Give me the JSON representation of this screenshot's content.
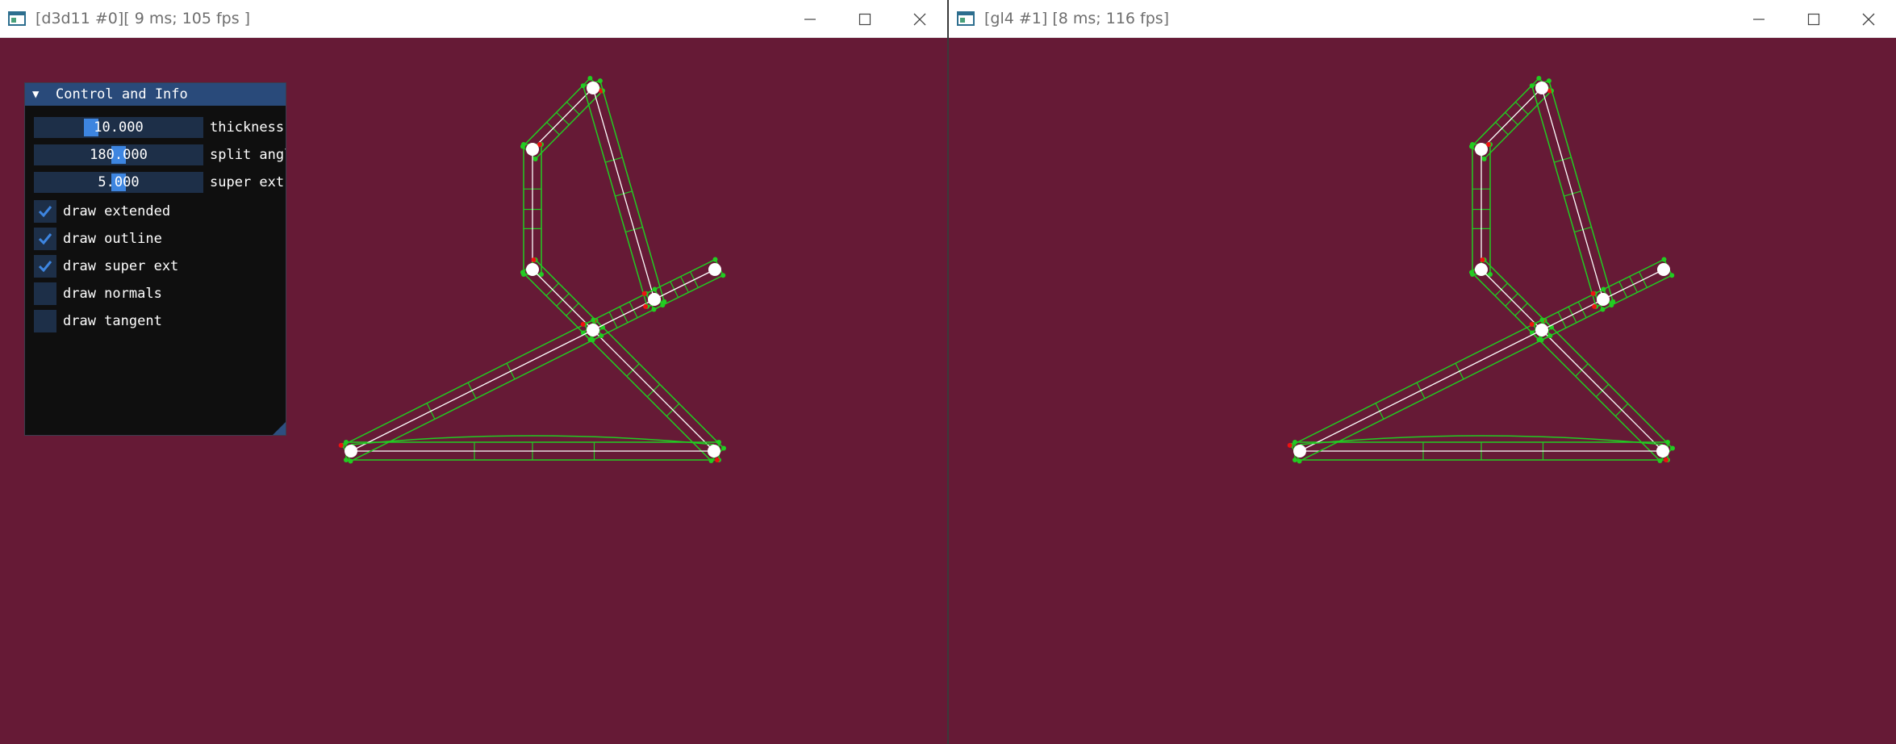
{
  "windows": [
    {
      "title": "[d3d11 #0][ 9 ms; 105 fps ]"
    },
    {
      "title": "[gl4 #1] [8 ms; 116 fps]"
    }
  ],
  "window_controls": {
    "minimize_icon": "minimize-icon",
    "maximize_icon": "maximize-icon",
    "close_icon": "close-icon"
  },
  "colors": {
    "background": "#661a36",
    "outline": "#22cc22",
    "centerline": "#ffffff",
    "joint": "#ffffff",
    "normal_marker": "#ee1111",
    "panel_header": "#294a7a",
    "slider_grab": "#3d85e0"
  },
  "panel": {
    "title": "Control and Info",
    "collapse_icon": "▼",
    "sliders": [
      {
        "value": "10.000",
        "label": "thickness",
        "fraction": 0.25
      },
      {
        "value": "180.000",
        "label": "split angle",
        "fraction": 0.5
      },
      {
        "value": "5.000",
        "label": "super ext",
        "fraction": 0.5
      }
    ],
    "checkboxes": [
      {
        "label": "draw extended",
        "checked": true
      },
      {
        "label": "draw outline",
        "checked": true
      },
      {
        "label": "draw super ext",
        "checked": true
      },
      {
        "label": "draw normals",
        "checked": false
      },
      {
        "label": "draw tangent",
        "checked": false
      }
    ]
  }
}
